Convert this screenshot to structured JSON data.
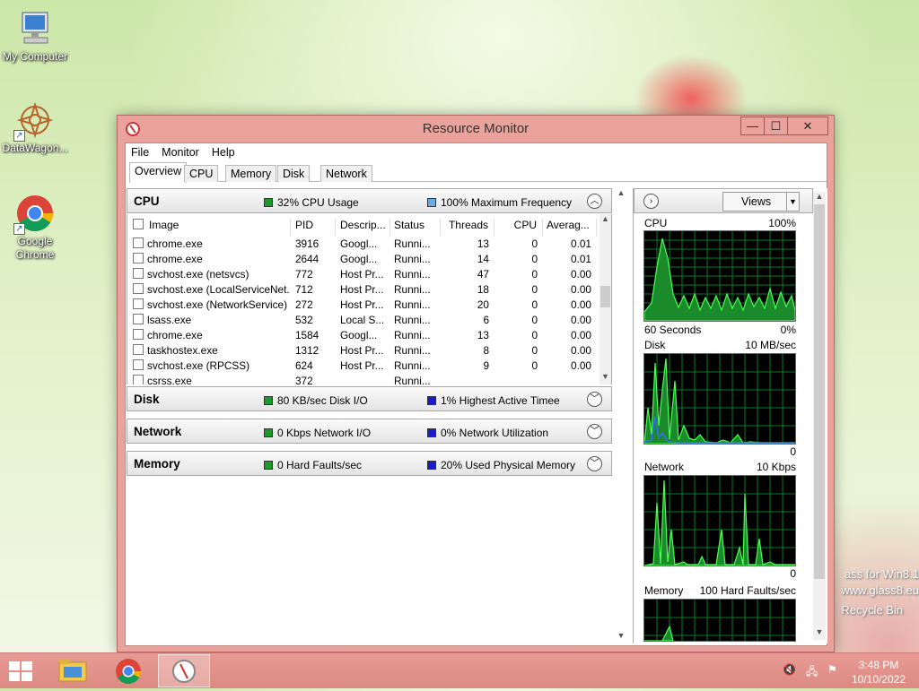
{
  "desktop": {
    "icons": [
      {
        "label": "My Computer",
        "icon": "my-computer-icon"
      },
      {
        "label": "DataWagon...",
        "icon": "datawagon-icon"
      },
      {
        "label": "Google Chrome",
        "icon": "chrome-icon"
      }
    ],
    "recycle_bin": "Recycle Bin",
    "watermark_line1": "ass for Win8.1",
    "watermark_line2": "www.glass8.eu"
  },
  "window": {
    "title": "Resource Monitor",
    "controls": {
      "minimize": "—",
      "maximize": "☐",
      "close": "✕"
    },
    "menu": [
      "File",
      "Monitor",
      "Help"
    ],
    "tabs": [
      "Overview",
      "CPU",
      "Memory",
      "Disk",
      "Network"
    ],
    "active_tab": "Overview"
  },
  "cpu_section": {
    "name": "CPU",
    "metric1": "32% CPU Usage",
    "metric2": "100% Maximum Frequency",
    "columns": [
      "Image",
      "PID",
      "Descrip...",
      "Status",
      "Threads",
      "CPU",
      "Averag..."
    ],
    "rows": [
      {
        "image": "chrome.exe",
        "pid": "3916",
        "desc": "Googl...",
        "status": "Runni...",
        "threads": "13",
        "cpu": "0",
        "avg": "0.01"
      },
      {
        "image": "chrome.exe",
        "pid": "2644",
        "desc": "Googl...",
        "status": "Runni...",
        "threads": "14",
        "cpu": "0",
        "avg": "0.01"
      },
      {
        "image": "svchost.exe (netsvcs)",
        "pid": "772",
        "desc": "Host Pr...",
        "status": "Runni...",
        "threads": "47",
        "cpu": "0",
        "avg": "0.00"
      },
      {
        "image": "svchost.exe (LocalServiceNet...",
        "pid": "712",
        "desc": "Host Pr...",
        "status": "Runni...",
        "threads": "18",
        "cpu": "0",
        "avg": "0.00"
      },
      {
        "image": "svchost.exe (NetworkService)",
        "pid": "272",
        "desc": "Host Pr...",
        "status": "Runni...",
        "threads": "20",
        "cpu": "0",
        "avg": "0.00"
      },
      {
        "image": "lsass.exe",
        "pid": "532",
        "desc": "Local S...",
        "status": "Runni...",
        "threads": "6",
        "cpu": "0",
        "avg": "0.00"
      },
      {
        "image": "chrome.exe",
        "pid": "1584",
        "desc": "Googl...",
        "status": "Runni...",
        "threads": "13",
        "cpu": "0",
        "avg": "0.00"
      },
      {
        "image": "taskhostex.exe",
        "pid": "1312",
        "desc": "Host Pr...",
        "status": "Runni...",
        "threads": "8",
        "cpu": "0",
        "avg": "0.00"
      },
      {
        "image": "svchost.exe (RPCSS)",
        "pid": "624",
        "desc": "Host Pr...",
        "status": "Runni...",
        "threads": "9",
        "cpu": "0",
        "avg": "0.00"
      },
      {
        "image": "csrss.exe",
        "pid": "372",
        "desc": "",
        "status": "Runni...",
        "threads": "",
        "cpu": "",
        "avg": ""
      }
    ]
  },
  "disk_section": {
    "name": "Disk",
    "metric1": "80 KB/sec Disk I/O",
    "metric2": "1% Highest Active Timee"
  },
  "network_section": {
    "name": "Network",
    "metric1": "0 Kbps Network I/O",
    "metric2": "0% Network Utilization"
  },
  "memory_section": {
    "name": "Memory",
    "metric1": "0 Hard Faults/sec",
    "metric2": "20% Used Physical Memory"
  },
  "graphs": {
    "views_label": "Views",
    "cpu": {
      "title": "CPU",
      "max": "100%",
      "foot_left": "60 Seconds",
      "foot_right": "0%"
    },
    "disk": {
      "title": "Disk",
      "max": "10 MB/sec",
      "foot_right": "0"
    },
    "network": {
      "title": "Network",
      "max": "10 Kbps",
      "foot_right": "0"
    },
    "memory": {
      "title": "Memory",
      "max": "100 Hard Faults/sec"
    }
  },
  "taskbar": {
    "apps": [
      {
        "name": "file-explorer",
        "icon": "folder-icon"
      },
      {
        "name": "chrome",
        "icon": "chrome-icon"
      },
      {
        "name": "resource-monitor",
        "icon": "resource-monitor-icon",
        "active": true
      }
    ],
    "time": "3:48 PM",
    "date": "10/10/2022"
  },
  "colors": {
    "window_frame": "#e9a39c",
    "graph_green": "#2ecc40",
    "graph_grid": "#0a7a2a"
  }
}
